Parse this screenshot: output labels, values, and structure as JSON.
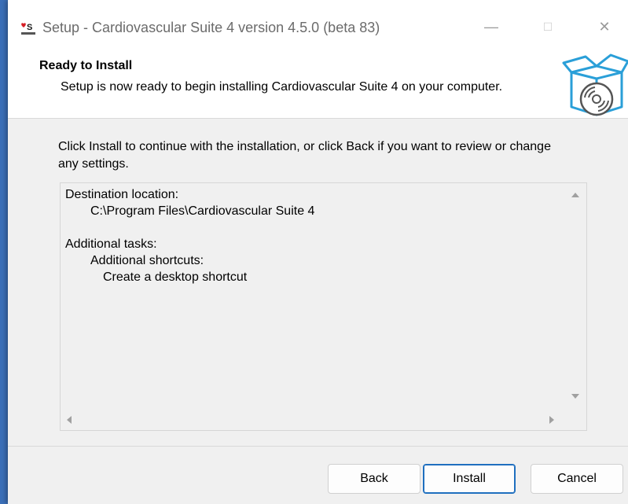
{
  "window": {
    "title": "Setup - Cardiovascular Suite 4 version 4.5.0 (beta 83)",
    "controls": {
      "minimize": "—",
      "maximize": "☐",
      "close": "✕"
    }
  },
  "header": {
    "title": "Ready to Install",
    "subtitle": "Setup is now ready to begin installing Cardiovascular Suite 4 on your computer.",
    "icon": "box-disc-icon"
  },
  "body": {
    "intro": "Click Install to continue with the installation, or click Back if you want to review or change any settings.",
    "memo": {
      "destination_heading": "Destination location:",
      "destination_path": "C:\\Program Files\\Cardiovascular Suite 4",
      "tasks_heading": "Additional tasks:",
      "shortcuts_heading": "Additional shortcuts:",
      "shortcut_item": "Create a desktop shortcut"
    }
  },
  "buttons": {
    "back": "Back",
    "install": "Install",
    "cancel": "Cancel"
  },
  "colors": {
    "accent": "#1f6fbf",
    "window_bg": "#f0f0f0",
    "logo_red": "#d61f26"
  }
}
